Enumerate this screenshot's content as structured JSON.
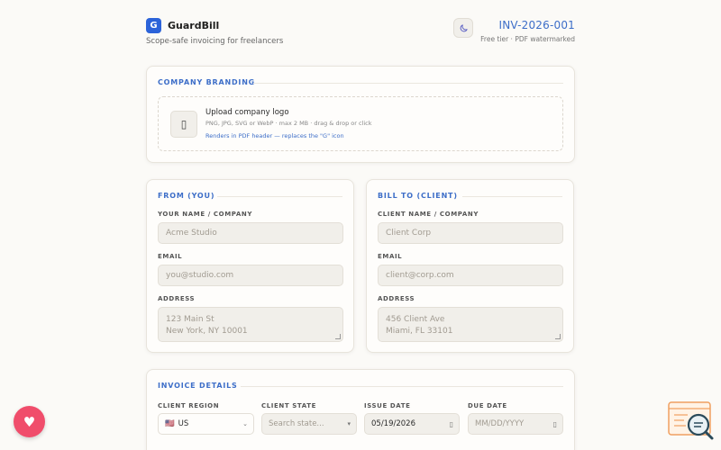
{
  "app": {
    "logo_letter": "G",
    "name": "GuardBill",
    "tagline": "Scope-safe invoicing for freelancers",
    "invoice_number": "INV-2026-001",
    "tier_note": "Free tier · PDF watermarked"
  },
  "branding": {
    "title": "COMPANY BRANDING",
    "upload_icon": "image-icon",
    "upload_title": "Upload company logo",
    "upload_sub": "PNG, JPG, SVG or WebP · max 2 MB · drag & drop or click",
    "upload_note": "Renders in PDF header — replaces the \"G\" icon"
  },
  "from": {
    "title": "FROM (YOU)",
    "name_label": "YOUR NAME / COMPANY",
    "name_placeholder": "Acme Studio",
    "email_label": "EMAIL",
    "email_placeholder": "you@studio.com",
    "address_label": "ADDRESS",
    "address_line1": "123 Main St",
    "address_line2": "New York, NY 10001"
  },
  "to": {
    "title": "BILL TO (CLIENT)",
    "name_label": "CLIENT NAME / COMPANY",
    "name_placeholder": "Client Corp",
    "email_label": "EMAIL",
    "email_placeholder": "client@corp.com",
    "address_label": "ADDRESS",
    "address_line1": "456 Client Ave",
    "address_line2": "Miami, FL 33101"
  },
  "details": {
    "title": "INVOICE DETAILS",
    "region_label": "CLIENT REGION",
    "region_value": "US",
    "region_flag": "🇺🇸",
    "state_label": "CLIENT STATE",
    "state_placeholder": "Search state...",
    "issue_label": "ISSUE DATE",
    "issue_value": "05/19/2026",
    "due_label": "DUE DATE",
    "due_placeholder": "MM/DD/YYYY"
  },
  "colors": {
    "accent": "#3d6ec8",
    "brand": "#2c63d9",
    "fab": "#f04d6b"
  }
}
